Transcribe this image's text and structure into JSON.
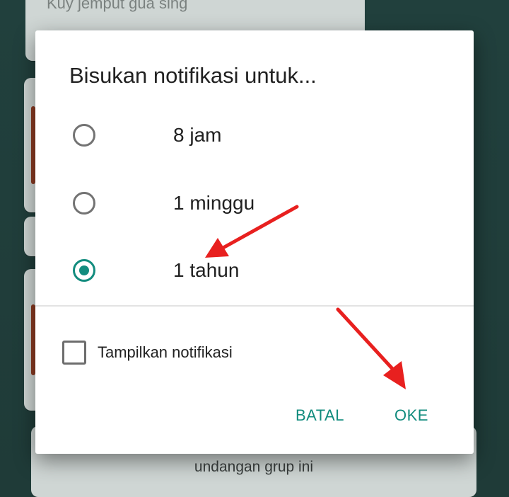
{
  "background": {
    "top_message": "Kuy jemput gua sing",
    "bottom_message": "undangan grup ini"
  },
  "dialog": {
    "title": "Bisukan notifikasi untuk...",
    "options": [
      {
        "label": "8 jam",
        "selected": false
      },
      {
        "label": "1 minggu",
        "selected": false
      },
      {
        "label": "1 tahun",
        "selected": true
      }
    ],
    "checkbox": {
      "label": "Tampilkan notifikasi",
      "checked": false
    },
    "buttons": {
      "cancel": "BATAL",
      "ok": "OKE"
    }
  },
  "colors": {
    "accent": "#128c7e",
    "annotation_arrow": "#e8201f",
    "backdrop": "#1f3b38"
  }
}
